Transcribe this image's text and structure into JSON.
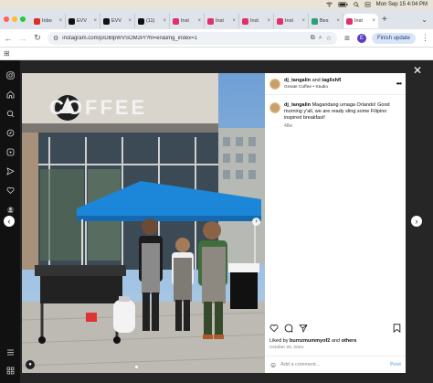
{
  "menubar": {
    "datetime": "Mon Sep 15  4:04 PM",
    "icons": [
      "wifi-icon",
      "battery-icon",
      "search-icon",
      "control-center-icon"
    ]
  },
  "tabs": [
    {
      "label": "Inbo",
      "icon": "gmail-icon",
      "color": "#d93025",
      "active": false
    },
    {
      "label": "EVV",
      "icon": "x-icon",
      "color": "#111111",
      "active": false
    },
    {
      "label": "EVV",
      "icon": "x-icon",
      "color": "#111111",
      "active": false
    },
    {
      "label": "(11)",
      "icon": "x-icon",
      "color": "#111111",
      "active": false
    },
    {
      "label": "Inst",
      "icon": "instagram-icon",
      "color": "#e1306c",
      "active": false
    },
    {
      "label": "Inst",
      "icon": "instagram-icon",
      "color": "#e1306c",
      "active": false
    },
    {
      "label": "Inst",
      "icon": "instagram-icon",
      "color": "#e1306c",
      "active": false
    },
    {
      "label": "Inst",
      "icon": "instagram-icon",
      "color": "#e1306c",
      "active": false
    },
    {
      "label": "Bes",
      "icon": "c-icon",
      "color": "#2f9e77",
      "active": false
    },
    {
      "label": "Inst",
      "icon": "instagram-icon",
      "color": "#e1306c",
      "active": true
    }
  ],
  "address": {
    "url": "instagram.com/p/DBlpWVSOM2P/?hl=en&img_index=1",
    "profile_initial": "E",
    "finish_update": "Finish update"
  },
  "post": {
    "header_user": "dj_tangalin",
    "header_and": "and",
    "header_user2": "taglishfl",
    "header_sub": "Greate Coffee • Studio",
    "caption_user": "dj_tangalin",
    "caption_text": "Magandang umaga Orlando! Good morning y'all, we are ready sling some Filipino inspired breakfast!",
    "caption_age": "48w",
    "liked_prefix": "Liked by",
    "liked_user": "burnzmummyof2",
    "liked_and": "and",
    "liked_others": "others",
    "date": "October 26, 2024",
    "comment_placeholder": "Add a comment...",
    "post_label": "Post"
  },
  "photo": {
    "sign_text": "COFFEE"
  },
  "colors": {
    "tent": "#1c86d8",
    "instagram_blue": "#7fb5f5"
  }
}
